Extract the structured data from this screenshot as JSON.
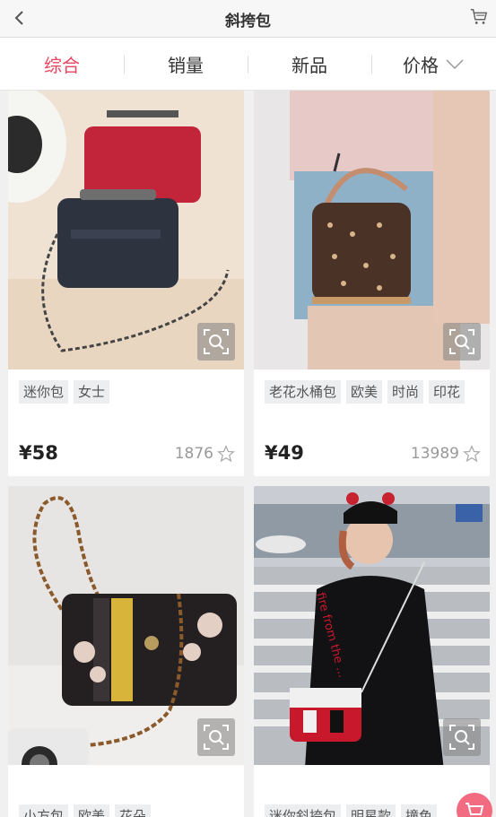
{
  "header": {
    "title": "斜挎包",
    "back_icon": "chevron-left-icon",
    "cart_icon": "cart-icon"
  },
  "tabs": [
    {
      "label": "综合",
      "active": true
    },
    {
      "label": "销量",
      "active": false
    },
    {
      "label": "新品",
      "active": false
    },
    {
      "label": "价格",
      "active": false,
      "icon": "chevron-down-icon"
    }
  ],
  "products": [
    {
      "tags": [
        "迷你包",
        "女士"
      ],
      "price": "¥58",
      "count": "1876"
    },
    {
      "tags": [
        "老花水桶包",
        "欧美",
        "时尚",
        "印花"
      ],
      "price": "¥49",
      "count": "13989"
    },
    {
      "tags": [
        "小方包",
        "欧美",
        "花朵"
      ],
      "price": "",
      "count": ""
    },
    {
      "tags": [
        "迷你斜挎包",
        "明星款",
        "撞色"
      ],
      "price": "",
      "count": ""
    }
  ],
  "colors": {
    "accent": "#e8455f",
    "fab": "#f26b80"
  }
}
